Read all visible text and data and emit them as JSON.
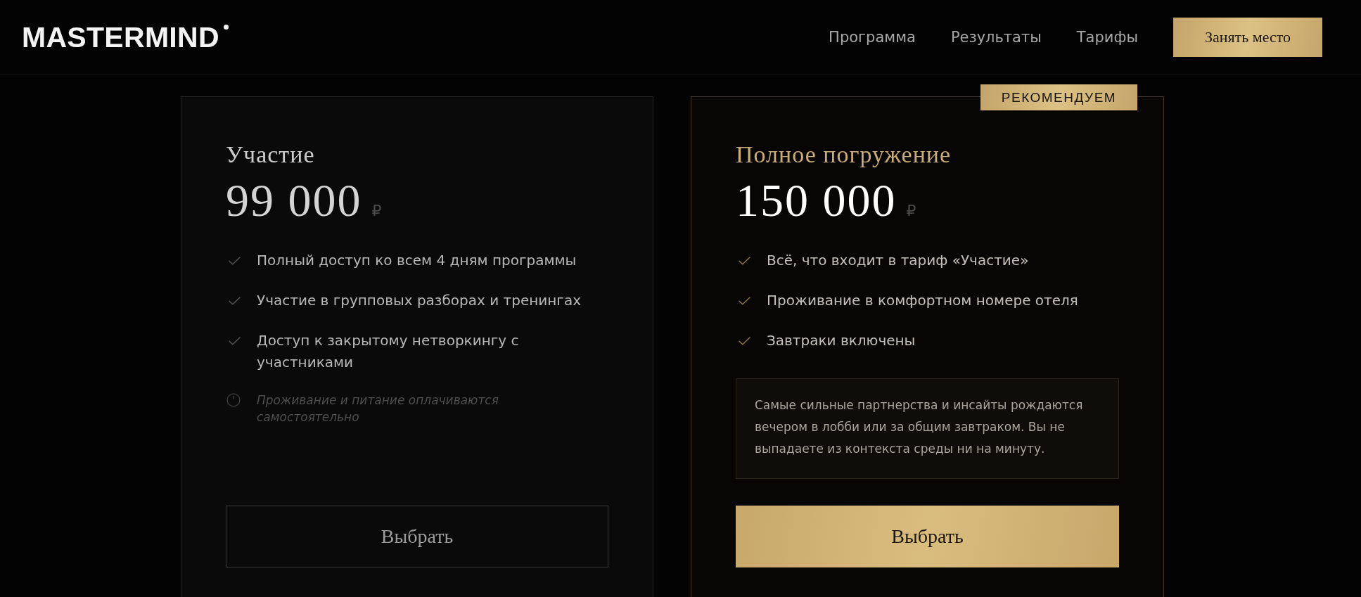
{
  "header": {
    "logo": "MASTERMIND",
    "nav": [
      {
        "label": "Программа"
      },
      {
        "label": "Результаты"
      },
      {
        "label": "Тарифы"
      }
    ],
    "cta": "Занять место"
  },
  "plans": [
    {
      "featured": false,
      "title": "Участие",
      "price": "99 000",
      "currency": "₽",
      "features": [
        {
          "kind": "included",
          "text": "Полный доступ ко всем 4 дням программы"
        },
        {
          "kind": "included",
          "text": "Участие в групповых разборах и тренингах"
        },
        {
          "kind": "included",
          "text": "Доступ к закрытому нетворкингу с участниками"
        },
        {
          "kind": "note",
          "text": "Проживание и питание оплачиваются самостоятельно"
        }
      ],
      "button": "Выбрать"
    },
    {
      "featured": true,
      "badge": "РЕКОМЕНДУЕМ",
      "title": "Полное погружение",
      "price": "150 000",
      "currency": "₽",
      "features": [
        {
          "kind": "included",
          "text": "Всё, что входит в тариф «Участие»"
        },
        {
          "kind": "included",
          "text": "Проживание в комфортном номере отеля"
        },
        {
          "kind": "included",
          "text": "Завтраки включены"
        }
      ],
      "callout": "Самые сильные партнерства и инсайты рождаются вечером в лобби или за общим завтраком. Вы не выпадаете из контекста среды ни на минуту.",
      "button": "Выбрать"
    }
  ]
}
